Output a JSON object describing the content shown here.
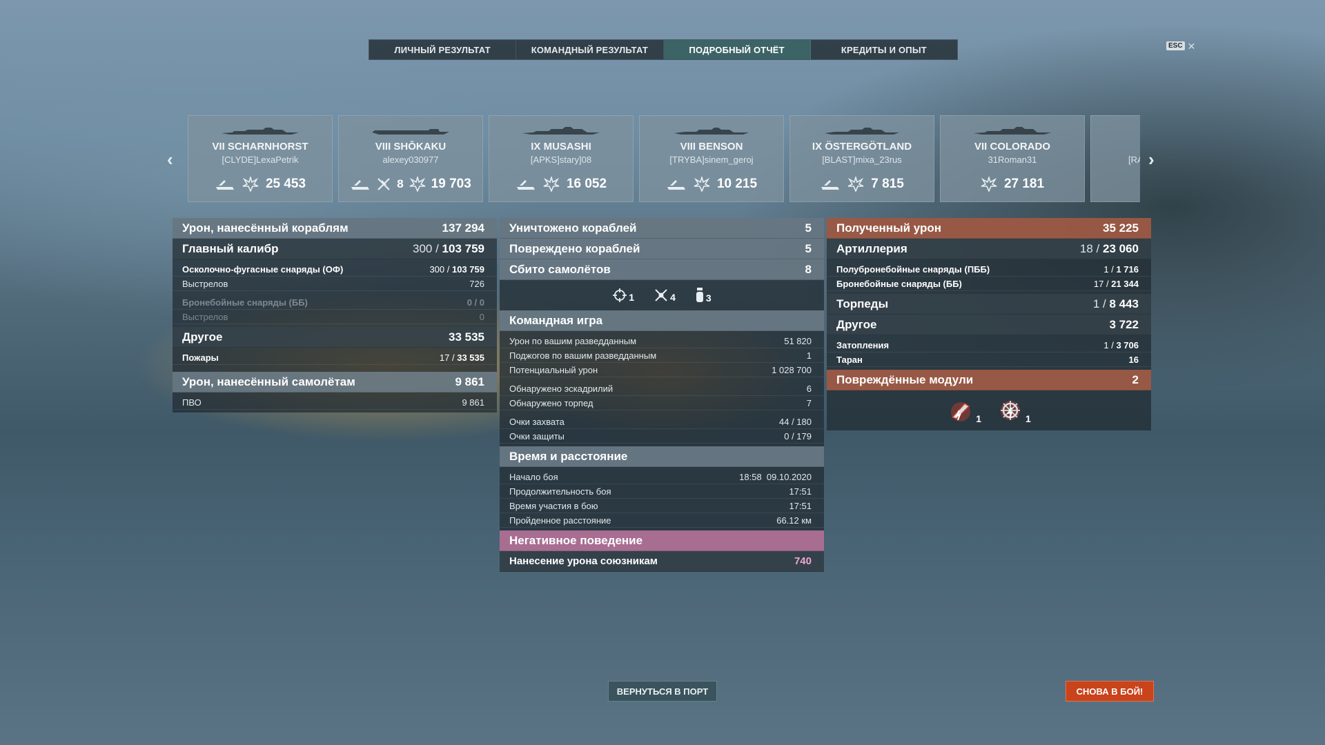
{
  "tabs": [
    {
      "label": "ЛИЧНЫЙ РЕЗУЛЬТАТ"
    },
    {
      "label": "КОМАНДНЫЙ РЕЗУЛЬТАТ"
    },
    {
      "label": "ПОДРОБНЫЙ ОТЧЁТ"
    },
    {
      "label": "КРЕДИТЫ И ОПЫТ"
    }
  ],
  "active_tab": "ПОДРОБНЫЙ ОТЧЁТ",
  "esc_label": "ESC",
  "ships": [
    {
      "name": "VII SCHARNHORST",
      "player": "[CLYDE]LexaPetrik",
      "damage": "25 453"
    },
    {
      "name": "VIII SHŌKAKU",
      "player": "alexey030977",
      "planes": "8",
      "damage": "19 703"
    },
    {
      "name": "IX MUSASHI",
      "player": "[APKS]stary]08",
      "damage": "16 052"
    },
    {
      "name": "VIII BENSON",
      "player": "[TRYBA]sinem_geroj",
      "damage": "10 215"
    },
    {
      "name": "IX ÖSTERGÖTLAND",
      "player": "[BLAST]mixa_23rus",
      "damage": "7 815"
    },
    {
      "name": "VII COLORADO",
      "player": "31Roman31",
      "damage": "27 181"
    },
    {
      "name": "",
      "player": "[RA"
    }
  ],
  "left": {
    "dmg_ships": {
      "label": "Урон, нанесённый кораблям",
      "value": "137 294"
    },
    "main_cal": {
      "label": "Главный калибр",
      "hits": "300",
      "total": "103 759"
    },
    "he": {
      "label": "Осколочно-фугасные снаряды (ОФ)",
      "hits": "300",
      "total": "103 759"
    },
    "he_shots": {
      "label": "Выстрелов",
      "value": "726"
    },
    "ap": {
      "label": "Бронебойные снаряды (ББ)",
      "value": "0 / 0"
    },
    "ap_shots": {
      "label": "Выстрелов",
      "value": "0"
    },
    "other": {
      "label": "Другое",
      "value": "33 535"
    },
    "fires": {
      "label": "Пожары",
      "hits": "17",
      "total": "33 535"
    },
    "dmg_planes": {
      "label": "Урон, нанесённый самолётам",
      "value": "9 861"
    },
    "aa": {
      "label": "ПВО",
      "value": "9 861"
    }
  },
  "center": {
    "destroyed": {
      "label": "Уничтожено кораблей",
      "value": "5"
    },
    "damaged": {
      "label": "Повреждено кораблей",
      "value": "5"
    },
    "planes": {
      "label": "Сбито самолётов",
      "value": "8"
    },
    "plane_icons": {
      "fighter": "1",
      "attacker": "4",
      "bomber": "3"
    },
    "team": {
      "label": "Командная игра"
    },
    "team_rows": [
      {
        "label": "Урон по вашим разведданным",
        "value": "51 820"
      },
      {
        "label": "Поджогов по вашим разведданным",
        "value": "1"
      },
      {
        "label": "Потенциальный урон",
        "value": "1 028 700"
      },
      {
        "label": "Обнаружено эскадрилий",
        "value": "6"
      },
      {
        "label": "Обнаружено торпед",
        "value": "7"
      },
      {
        "label": "Очки захвата",
        "value": "44 / 180"
      },
      {
        "label": "Очки защиты",
        "value": "0 / 179"
      }
    ],
    "time": {
      "label": "Время и расстояние"
    },
    "time_rows": [
      {
        "label": "Начало боя",
        "value": "18:58  09.10.2020"
      },
      {
        "label": "Продолжительность боя",
        "value": "17:51"
      },
      {
        "label": "Время участия в бою",
        "value": "17:51"
      },
      {
        "label": "Пройденное расстояние",
        "value": "66.12 км"
      }
    ],
    "negative": {
      "label": "Негативное поведение"
    },
    "team_damage": {
      "label": "Нанесение урона союзникам",
      "value": "740"
    }
  },
  "right": {
    "received": {
      "label": "Полученный урон",
      "value": "35 225"
    },
    "artillery": {
      "label": "Артиллерия",
      "hits": "18",
      "total": "23 060"
    },
    "sap": {
      "label": "Полубронебойные снаряды (ПББ)",
      "hits": "1",
      "total": "1 716"
    },
    "ap": {
      "label": "Бронебойные снаряды (ББ)",
      "hits": "17",
      "total": "21 344"
    },
    "torps": {
      "label": "Торпеды",
      "hits": "1",
      "total": "8 443"
    },
    "other": {
      "label": "Другое",
      "value": "3 722"
    },
    "flooding": {
      "label": "Затопления",
      "hits": "1",
      "total": "3 706"
    },
    "ram": {
      "label": "Таран",
      "value": "16"
    },
    "modules": {
      "label": "Повреждённые модули",
      "value": "2"
    },
    "module_icons": {
      "guns": "1",
      "steering": "1"
    }
  },
  "buttons": {
    "port": "ВЕРНУТЬСЯ В ПОРТ",
    "fight": "СНОВА В БОЙ!"
  },
  "colors": {
    "accent_orange": "#c9431b",
    "received_header": "#aa5f46",
    "negative_header": "#be78a0",
    "team_damage_value": "#f0a6d0",
    "active_tab": "#46827d"
  }
}
